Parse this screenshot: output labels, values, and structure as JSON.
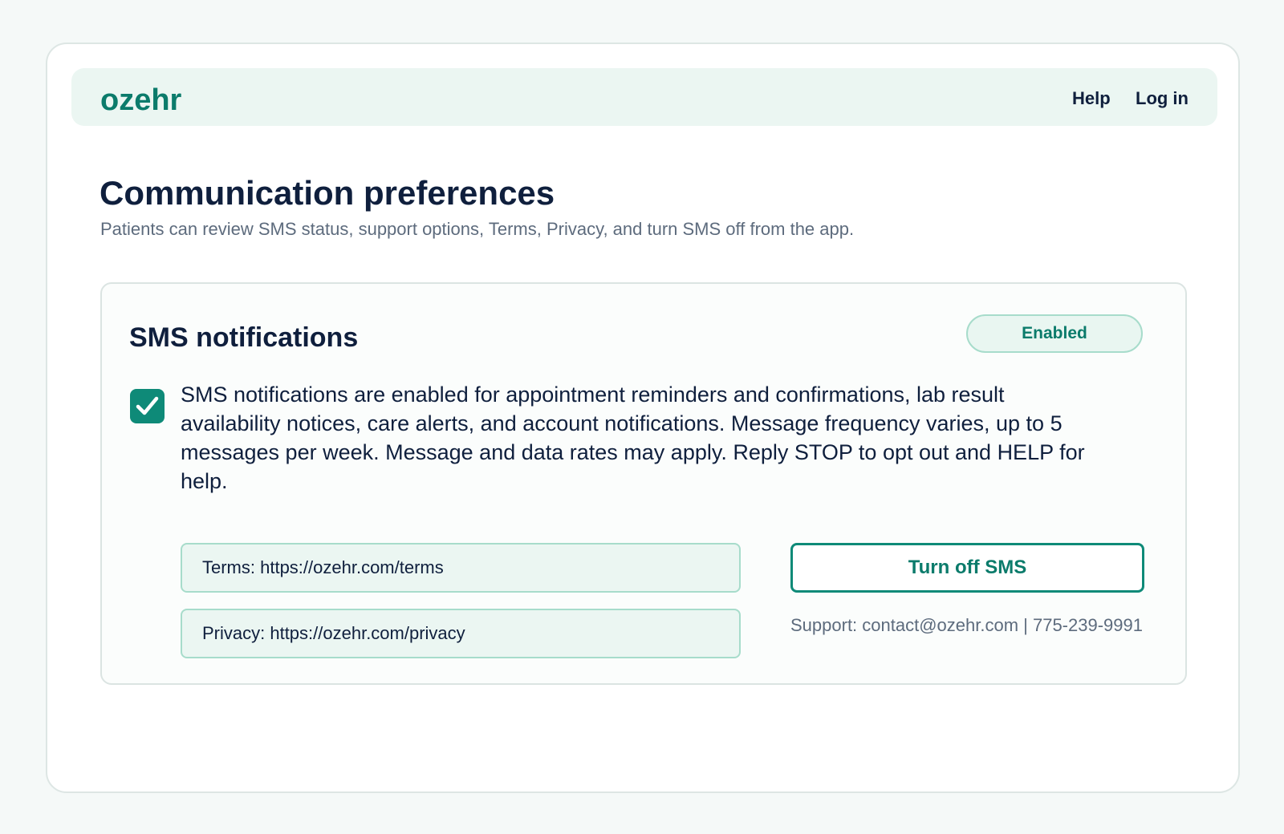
{
  "brand": "ozehr",
  "nav": {
    "help": "Help",
    "login": "Log in"
  },
  "page": {
    "title": "Communication preferences",
    "subtitle": "Patients can review SMS status, support options, Terms, Privacy, and turn SMS off from the app."
  },
  "sms_card": {
    "title": "SMS notifications",
    "status": "Enabled",
    "checkbox_checked": true,
    "consent_text": "SMS notifications are enabled for appointment reminders and confirmations, lab result availability notices, care alerts, and account notifications. Message frequency varies, up to 5 messages per week. Message and data rates may apply. Reply STOP to opt out and HELP for help.",
    "terms_link": "Terms: https://ozehr.com/terms",
    "privacy_link": "Privacy: https://ozehr.com/privacy",
    "turn_off_label": "Turn off SMS",
    "support": "Support: contact@ozehr.com | 775-239-9991"
  },
  "icons": {
    "checkbox": "checkmark-icon"
  },
  "colors": {
    "accent": "#0e8a78",
    "brand_text": "#0b7b6b",
    "nav_bg": "#ebf6f2",
    "text": "#0f1f3d",
    "muted": "#5d6b7d"
  }
}
